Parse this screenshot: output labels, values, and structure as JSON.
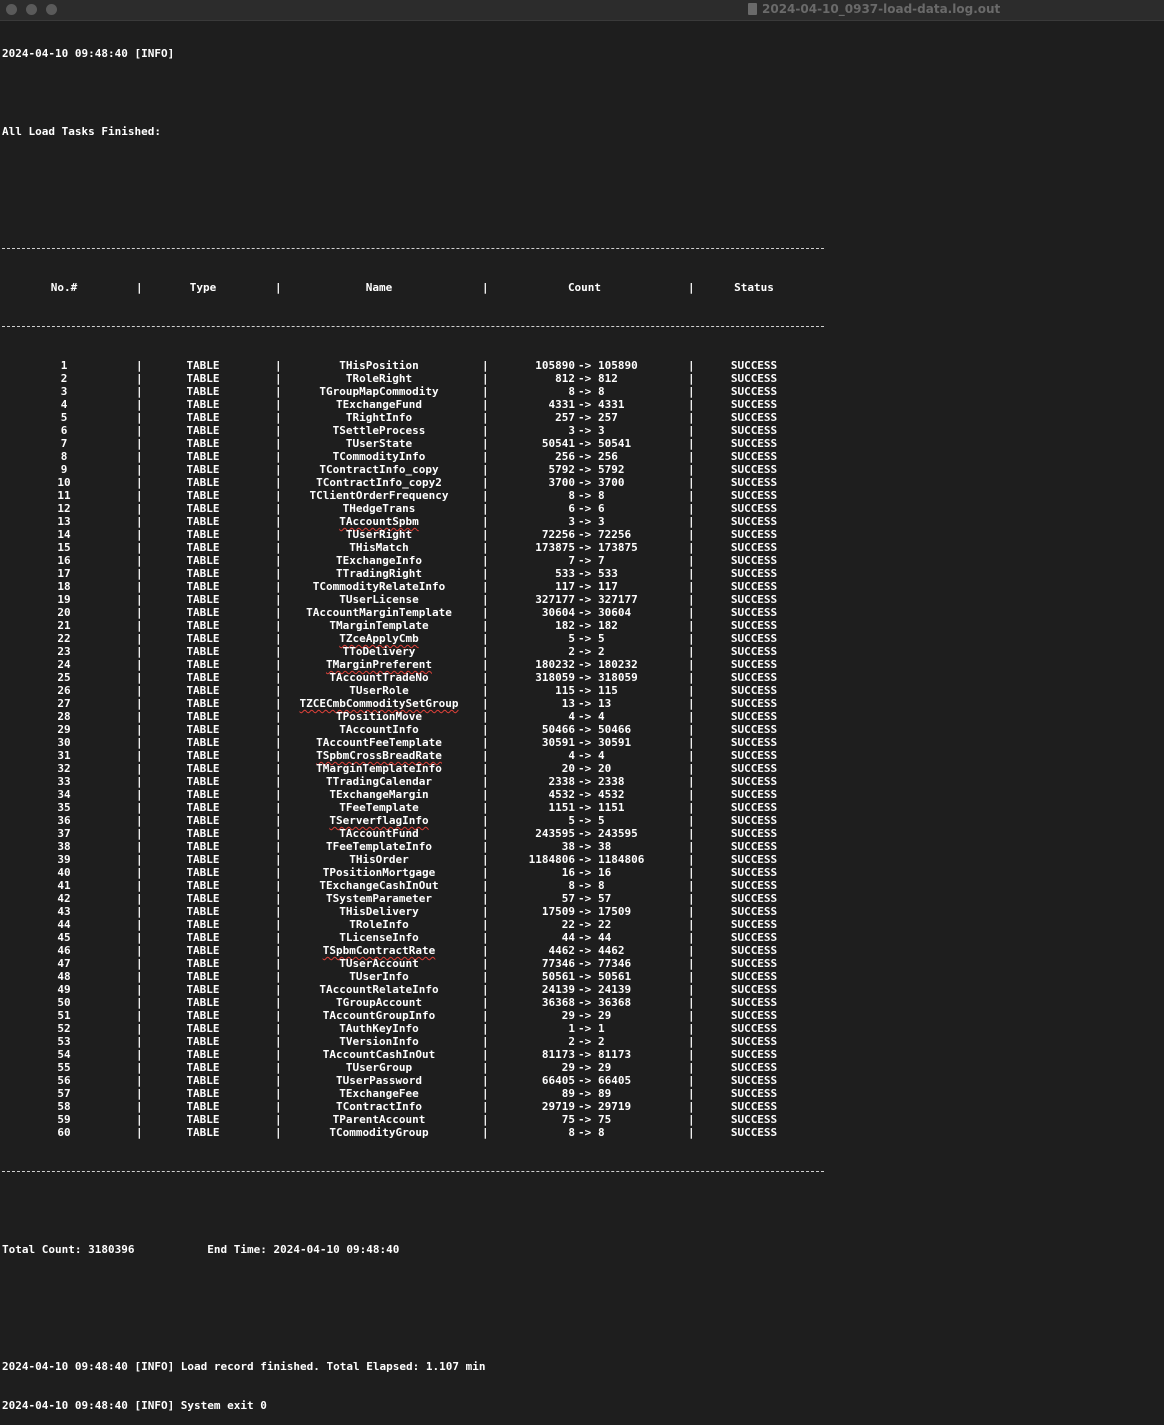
{
  "window": {
    "title": "2024-04-10_0937-load-data.log.out",
    "file_icon": "document-icon"
  },
  "log": {
    "start_line": "2024-04-10 09:48:40 [INFO]",
    "tasks_finished": "All Load Tasks Finished:",
    "headers": {
      "no": "No.#",
      "type": "Type",
      "name": "Name",
      "count": "Count",
      "status": "Status"
    },
    "column_separator": "|",
    "count_arrow": "->",
    "rows": [
      {
        "no": "1",
        "type": "TABLE",
        "name": "THisPosition",
        "src": "105890",
        "dst": "105890",
        "status": "SUCCESS"
      },
      {
        "no": "2",
        "type": "TABLE",
        "name": "TRoleRight",
        "src": "812",
        "dst": "812",
        "status": "SUCCESS"
      },
      {
        "no": "3",
        "type": "TABLE",
        "name": "TGroupMapCommodity",
        "src": "8",
        "dst": "8",
        "status": "SUCCESS"
      },
      {
        "no": "4",
        "type": "TABLE",
        "name": "TExchangeFund",
        "src": "4331",
        "dst": "4331",
        "status": "SUCCESS"
      },
      {
        "no": "5",
        "type": "TABLE",
        "name": "TRightInfo",
        "src": "257",
        "dst": "257",
        "status": "SUCCESS"
      },
      {
        "no": "6",
        "type": "TABLE",
        "name": "TSettleProcess",
        "src": "3",
        "dst": "3",
        "status": "SUCCESS"
      },
      {
        "no": "7",
        "type": "TABLE",
        "name": "TUserState",
        "src": "50541",
        "dst": "50541",
        "status": "SUCCESS"
      },
      {
        "no": "8",
        "type": "TABLE",
        "name": "TCommodityInfo",
        "src": "256",
        "dst": "256",
        "status": "SUCCESS"
      },
      {
        "no": "9",
        "type": "TABLE",
        "name": "TContractInfo_copy",
        "src": "5792",
        "dst": "5792",
        "status": "SUCCESS"
      },
      {
        "no": "10",
        "type": "TABLE",
        "name": "TContractInfo_copy2",
        "src": "3700",
        "dst": "3700",
        "status": "SUCCESS"
      },
      {
        "no": "11",
        "type": "TABLE",
        "name": "TClientOrderFrequency",
        "src": "8",
        "dst": "8",
        "status": "SUCCESS"
      },
      {
        "no": "12",
        "type": "TABLE",
        "name": "THedgeTrans",
        "src": "6",
        "dst": "6",
        "status": "SUCCESS"
      },
      {
        "no": "13",
        "type": "TABLE",
        "name": "TAccountSpbm",
        "src": "3",
        "dst": "3",
        "status": "SUCCESS",
        "spell": true
      },
      {
        "no": "14",
        "type": "TABLE",
        "name": "TUserRight",
        "src": "72256",
        "dst": "72256",
        "status": "SUCCESS"
      },
      {
        "no": "15",
        "type": "TABLE",
        "name": "THisMatch",
        "src": "173875",
        "dst": "173875",
        "status": "SUCCESS"
      },
      {
        "no": "16",
        "type": "TABLE",
        "name": "TExchangeInfo",
        "src": "7",
        "dst": "7",
        "status": "SUCCESS"
      },
      {
        "no": "17",
        "type": "TABLE",
        "name": "TTradingRight",
        "src": "533",
        "dst": "533",
        "status": "SUCCESS"
      },
      {
        "no": "18",
        "type": "TABLE",
        "name": "TCommodityRelateInfo",
        "src": "117",
        "dst": "117",
        "status": "SUCCESS"
      },
      {
        "no": "19",
        "type": "TABLE",
        "name": "TUserLicense",
        "src": "327177",
        "dst": "327177",
        "status": "SUCCESS"
      },
      {
        "no": "20",
        "type": "TABLE",
        "name": "TAccountMarginTemplate",
        "src": "30604",
        "dst": "30604",
        "status": "SUCCESS"
      },
      {
        "no": "21",
        "type": "TABLE",
        "name": "TMarginTemplate",
        "src": "182",
        "dst": "182",
        "status": "SUCCESS"
      },
      {
        "no": "22",
        "type": "TABLE",
        "name": "TZceApplyCmb",
        "src": "5",
        "dst": "5",
        "status": "SUCCESS",
        "spell": true
      },
      {
        "no": "23",
        "type": "TABLE",
        "name": "TToDelivery",
        "src": "2",
        "dst": "2",
        "status": "SUCCESS"
      },
      {
        "no": "24",
        "type": "TABLE",
        "name": "TMarginPreferent",
        "src": "180232",
        "dst": "180232",
        "status": "SUCCESS",
        "spell": true
      },
      {
        "no": "25",
        "type": "TABLE",
        "name": "TAccountTradeNo",
        "src": "318059",
        "dst": "318059",
        "status": "SUCCESS"
      },
      {
        "no": "26",
        "type": "TABLE",
        "name": "TUserRole",
        "src": "115",
        "dst": "115",
        "status": "SUCCESS"
      },
      {
        "no": "27",
        "type": "TABLE",
        "name": "TZCECmbCommoditySetGroup",
        "src": "13",
        "dst": "13",
        "status": "SUCCESS",
        "spell": true
      },
      {
        "no": "28",
        "type": "TABLE",
        "name": "TPositionMove",
        "src": "4",
        "dst": "4",
        "status": "SUCCESS"
      },
      {
        "no": "29",
        "type": "TABLE",
        "name": "TAccountInfo",
        "src": "50466",
        "dst": "50466",
        "status": "SUCCESS"
      },
      {
        "no": "30",
        "type": "TABLE",
        "name": "TAccountFeeTemplate",
        "src": "30591",
        "dst": "30591",
        "status": "SUCCESS"
      },
      {
        "no": "31",
        "type": "TABLE",
        "name": "TSpbmCrossBreadRate",
        "src": "4",
        "dst": "4",
        "status": "SUCCESS",
        "spell": true
      },
      {
        "no": "32",
        "type": "TABLE",
        "name": "TMarginTemplateInfo",
        "src": "20",
        "dst": "20",
        "status": "SUCCESS"
      },
      {
        "no": "33",
        "type": "TABLE",
        "name": "TTradingCalendar",
        "src": "2338",
        "dst": "2338",
        "status": "SUCCESS"
      },
      {
        "no": "34",
        "type": "TABLE",
        "name": "TExchangeMargin",
        "src": "4532",
        "dst": "4532",
        "status": "SUCCESS"
      },
      {
        "no": "35",
        "type": "TABLE",
        "name": "TFeeTemplate",
        "src": "1151",
        "dst": "1151",
        "status": "SUCCESS"
      },
      {
        "no": "36",
        "type": "TABLE",
        "name": "TServerflagInfo",
        "src": "5",
        "dst": "5",
        "status": "SUCCESS",
        "spell": true
      },
      {
        "no": "37",
        "type": "TABLE",
        "name": "TAccountFund",
        "src": "243595",
        "dst": "243595",
        "status": "SUCCESS"
      },
      {
        "no": "38",
        "type": "TABLE",
        "name": "TFeeTemplateInfo",
        "src": "38",
        "dst": "38",
        "status": "SUCCESS"
      },
      {
        "no": "39",
        "type": "TABLE",
        "name": "THisOrder",
        "src": "1184806",
        "dst": "1184806",
        "status": "SUCCESS"
      },
      {
        "no": "40",
        "type": "TABLE",
        "name": "TPositionMortgage",
        "src": "16",
        "dst": "16",
        "status": "SUCCESS"
      },
      {
        "no": "41",
        "type": "TABLE",
        "name": "TExchangeCashInOut",
        "src": "8",
        "dst": "8",
        "status": "SUCCESS"
      },
      {
        "no": "42",
        "type": "TABLE",
        "name": "TSystemParameter",
        "src": "57",
        "dst": "57",
        "status": "SUCCESS"
      },
      {
        "no": "43",
        "type": "TABLE",
        "name": "THisDelivery",
        "src": "17509",
        "dst": "17509",
        "status": "SUCCESS"
      },
      {
        "no": "44",
        "type": "TABLE",
        "name": "TRoleInfo",
        "src": "22",
        "dst": "22",
        "status": "SUCCESS"
      },
      {
        "no": "45",
        "type": "TABLE",
        "name": "TLicenseInfo",
        "src": "44",
        "dst": "44",
        "status": "SUCCESS"
      },
      {
        "no": "46",
        "type": "TABLE",
        "name": "TSpbmContractRate",
        "src": "4462",
        "dst": "4462",
        "status": "SUCCESS",
        "spell": true
      },
      {
        "no": "47",
        "type": "TABLE",
        "name": "TUserAccount",
        "src": "77346",
        "dst": "77346",
        "status": "SUCCESS"
      },
      {
        "no": "48",
        "type": "TABLE",
        "name": "TUserInfo",
        "src": "50561",
        "dst": "50561",
        "status": "SUCCESS"
      },
      {
        "no": "49",
        "type": "TABLE",
        "name": "TAccountRelateInfo",
        "src": "24139",
        "dst": "24139",
        "status": "SUCCESS"
      },
      {
        "no": "50",
        "type": "TABLE",
        "name": "TGroupAccount",
        "src": "36368",
        "dst": "36368",
        "status": "SUCCESS"
      },
      {
        "no": "51",
        "type": "TABLE",
        "name": "TAccountGroupInfo",
        "src": "29",
        "dst": "29",
        "status": "SUCCESS"
      },
      {
        "no": "52",
        "type": "TABLE",
        "name": "TAuthKeyInfo",
        "src": "1",
        "dst": "1",
        "status": "SUCCESS"
      },
      {
        "no": "53",
        "type": "TABLE",
        "name": "TVersionInfo",
        "src": "2",
        "dst": "2",
        "status": "SUCCESS"
      },
      {
        "no": "54",
        "type": "TABLE",
        "name": "TAccountCashInOut",
        "src": "81173",
        "dst": "81173",
        "status": "SUCCESS"
      },
      {
        "no": "55",
        "type": "TABLE",
        "name": "TUserGroup",
        "src": "29",
        "dst": "29",
        "status": "SUCCESS"
      },
      {
        "no": "56",
        "type": "TABLE",
        "name": "TUserPassword",
        "src": "66405",
        "dst": "66405",
        "status": "SUCCESS"
      },
      {
        "no": "57",
        "type": "TABLE",
        "name": "TExchangeFee",
        "src": "89",
        "dst": "89",
        "status": "SUCCESS"
      },
      {
        "no": "58",
        "type": "TABLE",
        "name": "TContractInfo",
        "src": "29719",
        "dst": "29719",
        "status": "SUCCESS"
      },
      {
        "no": "59",
        "type": "TABLE",
        "name": "TParentAccount",
        "src": "75",
        "dst": "75",
        "status": "SUCCESS"
      },
      {
        "no": "60",
        "type": "TABLE",
        "name": "TCommodityGroup",
        "src": "8",
        "dst": "8",
        "status": "SUCCESS"
      }
    ],
    "summary": "Total Count: 3180396           End Time: 2024-04-10 09:48:40",
    "finish_lines": [
      "2024-04-10 09:48:40 [INFO] Load record finished. Total Elapsed: 1.107 min",
      "2024-04-10 09:48:40 [INFO] System exit 0"
    ]
  }
}
